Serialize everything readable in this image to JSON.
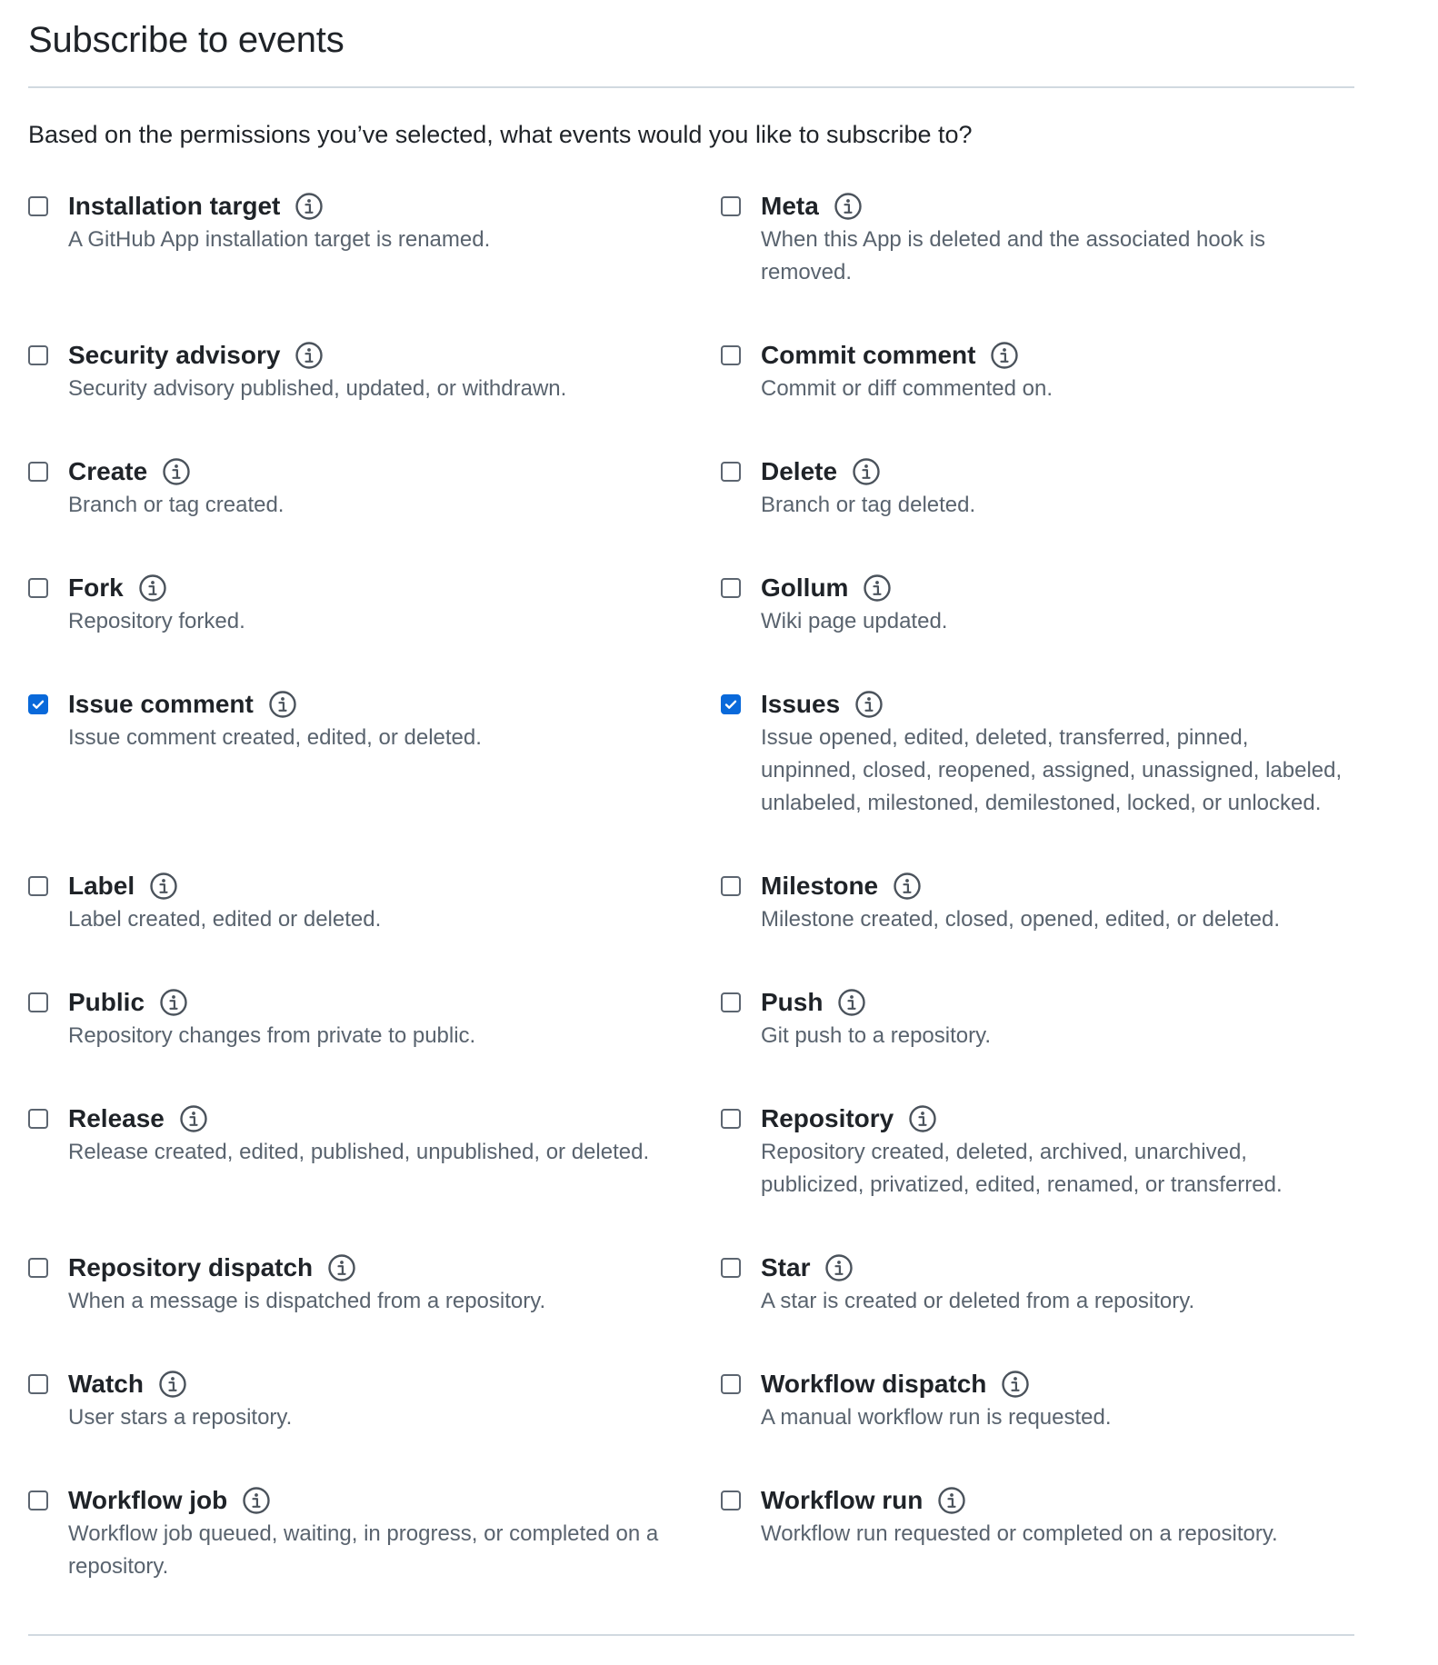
{
  "section": {
    "title": "Subscribe to events",
    "intro": "Based on the permissions you’ve selected, what events would you like to subscribe to?"
  },
  "colors": {
    "checkbox_checked": "#0969da",
    "text_primary": "#1f2328",
    "text_muted": "#59636e",
    "divider": "#d1d9e0"
  },
  "icons": {
    "info": "info-icon",
    "check": "check-icon"
  },
  "events": [
    {
      "name": "Installation target",
      "description": "A GitHub App installation target is renamed.",
      "checked": false
    },
    {
      "name": "Meta",
      "description": "When this App is deleted and the associated hook is removed.",
      "checked": false
    },
    {
      "name": "Security advisory",
      "description": "Security advisory published, updated, or withdrawn.",
      "checked": false
    },
    {
      "name": "Commit comment",
      "description": "Commit or diff commented on.",
      "checked": false
    },
    {
      "name": "Create",
      "description": "Branch or tag created.",
      "checked": false
    },
    {
      "name": "Delete",
      "description": "Branch or tag deleted.",
      "checked": false
    },
    {
      "name": "Fork",
      "description": "Repository forked.",
      "checked": false
    },
    {
      "name": "Gollum",
      "description": "Wiki page updated.",
      "checked": false
    },
    {
      "name": "Issue comment",
      "description": "Issue comment created, edited, or deleted.",
      "checked": true
    },
    {
      "name": "Issues",
      "description": "Issue opened, edited, deleted, transferred, pinned, unpinned, closed, reopened, assigned, unassigned, labeled, unlabeled, milestoned, demilestoned, locked, or unlocked.",
      "checked": true
    },
    {
      "name": "Label",
      "description": "Label created, edited or deleted.",
      "checked": false
    },
    {
      "name": "Milestone",
      "description": "Milestone created, closed, opened, edited, or deleted.",
      "checked": false
    },
    {
      "name": "Public",
      "description": "Repository changes from private to public.",
      "checked": false
    },
    {
      "name": "Push",
      "description": "Git push to a repository.",
      "checked": false
    },
    {
      "name": "Release",
      "description": "Release created, edited, published, unpublished, or deleted.",
      "checked": false
    },
    {
      "name": "Repository",
      "description": "Repository created, deleted, archived, unarchived, publicized, privatized, edited, renamed, or transferred.",
      "checked": false
    },
    {
      "name": "Repository dispatch",
      "description": "When a message is dispatched from a repository.",
      "checked": false
    },
    {
      "name": "Star",
      "description": "A star is created or deleted from a repository.",
      "checked": false
    },
    {
      "name": "Watch",
      "description": "User stars a repository.",
      "checked": false
    },
    {
      "name": "Workflow dispatch",
      "description": "A manual workflow run is requested.",
      "checked": false
    },
    {
      "name": "Workflow job",
      "description": "Workflow job queued, waiting, in progress, or completed on a repository.",
      "checked": false
    },
    {
      "name": "Workflow run",
      "description": "Workflow run requested or completed on a repository.",
      "checked": false
    }
  ]
}
